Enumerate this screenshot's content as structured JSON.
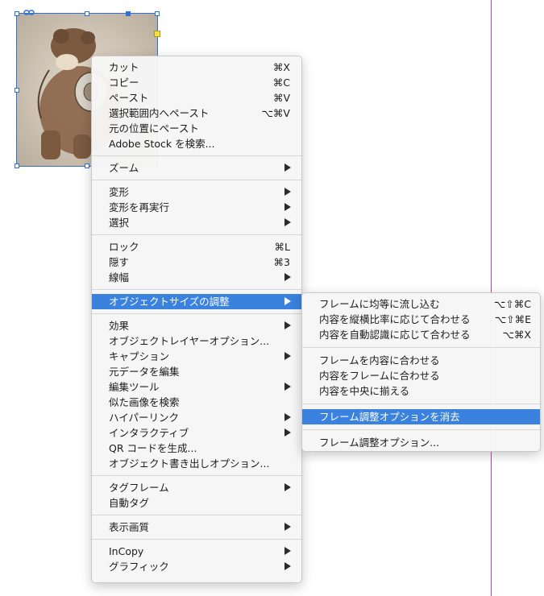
{
  "context_menu": {
    "groups": [
      [
        {
          "label": "カット",
          "shortcut": "⌘X"
        },
        {
          "label": "コピー",
          "shortcut": "⌘C"
        },
        {
          "label": "ペースト",
          "shortcut": "⌘V"
        },
        {
          "label": "選択範囲内へペースト",
          "shortcut": "⌥⌘V"
        },
        {
          "label": "元の位置にペースト",
          "shortcut": ""
        },
        {
          "label": "Adobe Stock を検索...",
          "shortcut": ""
        }
      ],
      [
        {
          "label": "ズーム",
          "submenu": true
        }
      ],
      [
        {
          "label": "変形",
          "submenu": true
        },
        {
          "label": "変形を再実行",
          "submenu": true
        },
        {
          "label": "選択",
          "submenu": true
        }
      ],
      [
        {
          "label": "ロック",
          "shortcut": "⌘L"
        },
        {
          "label": "隠す",
          "shortcut": "⌘3"
        },
        {
          "label": "線幅",
          "submenu": true
        }
      ],
      [
        {
          "label": "オブジェクトサイズの調整",
          "submenu": true,
          "selected": true
        }
      ],
      [
        {
          "label": "効果",
          "submenu": true
        },
        {
          "label": "オブジェクトレイヤーオプション...",
          "shortcut": ""
        },
        {
          "label": "キャプション",
          "submenu": true
        },
        {
          "label": "元データを編集",
          "shortcut": ""
        },
        {
          "label": "編集ツール",
          "submenu": true
        },
        {
          "label": "似た画像を検索",
          "shortcut": ""
        },
        {
          "label": "ハイパーリンク",
          "submenu": true
        },
        {
          "label": "インタラクティブ",
          "submenu": true
        },
        {
          "label": "QR コードを生成...",
          "shortcut": ""
        },
        {
          "label": "オブジェクト書き出しオプション...",
          "shortcut": ""
        }
      ],
      [
        {
          "label": "タグフレーム",
          "submenu": true
        },
        {
          "label": "自動タグ",
          "shortcut": ""
        }
      ],
      [
        {
          "label": "表示画質",
          "submenu": true
        }
      ],
      [
        {
          "label": "InCopy",
          "submenu": true
        },
        {
          "label": "グラフィック",
          "submenu": true
        }
      ]
    ]
  },
  "fitting_submenu": {
    "groups": [
      [
        {
          "label": "フレームに均等に流し込む",
          "shortcut": "⌥⇧⌘C"
        },
        {
          "label": "内容を縦横比率に応じて合わせる",
          "shortcut": "⌥⇧⌘E"
        },
        {
          "label": "内容を自動認識に応じて合わせる",
          "shortcut": "⌥⌘X"
        }
      ],
      [
        {
          "label": "フレームを内容に合わせる",
          "shortcut": ""
        },
        {
          "label": "内容をフレームに合わせる",
          "shortcut": ""
        },
        {
          "label": "内容を中央に揃える",
          "shortcut": ""
        }
      ],
      [
        {
          "label": "フレーム調整オプションを消去",
          "shortcut": "",
          "selected": true
        }
      ],
      [
        {
          "label": "フレーム調整オプション...",
          "shortcut": ""
        }
      ]
    ]
  },
  "colors": {
    "selection": "#3a82dd",
    "frame_selection": "#2f6fd6",
    "margin_guide": "#c83c9c",
    "content_grabber": "#f5e13c"
  },
  "canvas": {
    "placed_image": "bear-illustration-image",
    "link_badge": "link-icon"
  }
}
